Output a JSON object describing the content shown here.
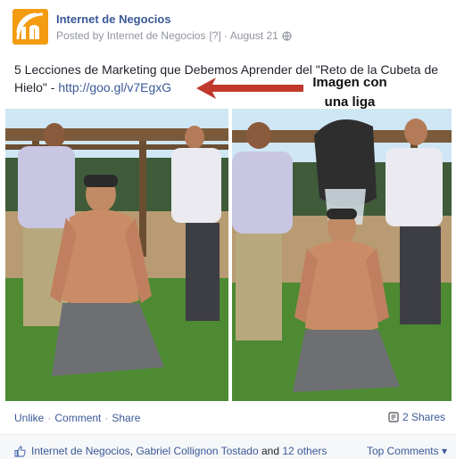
{
  "post": {
    "page_name": "Internet de Negocios",
    "posted_by": "Posted by Internet de Negocios",
    "help_marker": "[?]",
    "separator": "·",
    "date": "August 21",
    "text": "5 Lecciones de Marketing que Debemos Aprender del \"Reto de la Cubeta de Hielo\" - ",
    "link": "http://goo.gl/v7EgxG",
    "link_text": "http://goo.gl/v7EgxG"
  },
  "annotation": {
    "line1": "Imagen con",
    "line2": "una liga",
    "arrow_color": "#c0392b"
  },
  "actions": {
    "unlike": "Unlike",
    "comment": "Comment",
    "share": "Share",
    "separator": "·",
    "shares_count": "2 Shares"
  },
  "likes": {
    "liker1": "Internet de Negocios",
    "comma": ",",
    "liker2": "Gabriel Collignon Tostado",
    "and": "and",
    "others": "12 others",
    "top_comments": "Top Comments ▾"
  },
  "colors": {
    "link": "#3b5998",
    "brand_orange": "#f39c12"
  },
  "icons": {
    "avatar": "logo-icon",
    "globe": "globe-icon",
    "shares": "share-icon",
    "like": "thumbs-up-icon"
  }
}
